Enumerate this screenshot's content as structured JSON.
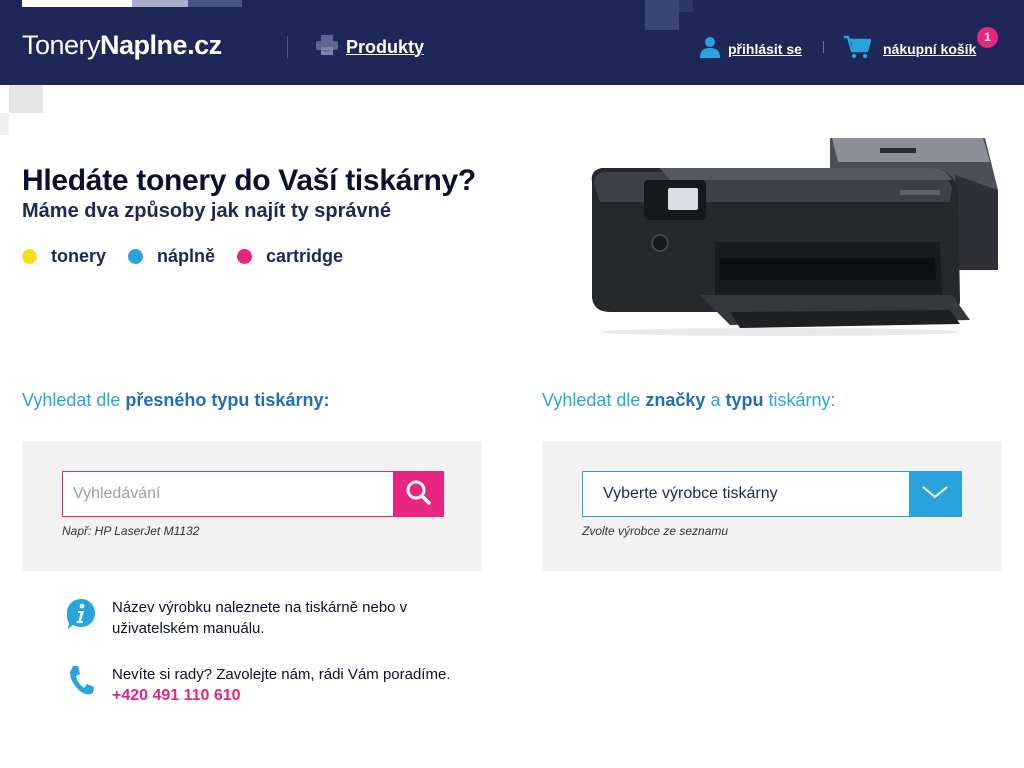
{
  "header": {
    "logo_light": "Tonery",
    "logo_bold": "Naplne.cz",
    "products_label": "Produkty",
    "login_label": "přihlásit se",
    "cart_label": "nákupní košík",
    "cart_count": "1"
  },
  "hero": {
    "title": "Hledáte tonery do Vaší tiskárny?",
    "subtitle": "Máme dva způsoby jak najít ty správné",
    "legend": [
      {
        "label": "tonery",
        "color": "#f7e11b"
      },
      {
        "label": "náplně",
        "color": "#29a3dc"
      },
      {
        "label": "cartridge",
        "color": "#e8257f"
      }
    ]
  },
  "search_exact": {
    "title_pre": "Vyhledat dle ",
    "title_bold": "přesného typu tiskárny:",
    "placeholder": "Vyhledávání",
    "hint": "Např: HP LaserJet M1132"
  },
  "search_brand": {
    "title_pre": "Vyhledat dle ",
    "title_bold1": "značky",
    "title_mid": " a ",
    "title_bold2": "typu",
    "title_post": " tiskárny:",
    "select_value": "Vyberte výrobce tiskárny",
    "hint": "Zvolte výrobce ze seznamu"
  },
  "info": {
    "model_text": "Název výrobku naleznete na tiskárně nebo v uživatelském manuálu.",
    "help_text": "Nevíte si rady? Zavolejte nám, rádi Vám poradíme.",
    "phone": "+420 491 110 610"
  },
  "colors": {
    "navy": "#1e2757",
    "pink": "#e8257f",
    "blue": "#29a3dc",
    "yellow": "#f7e11b"
  }
}
